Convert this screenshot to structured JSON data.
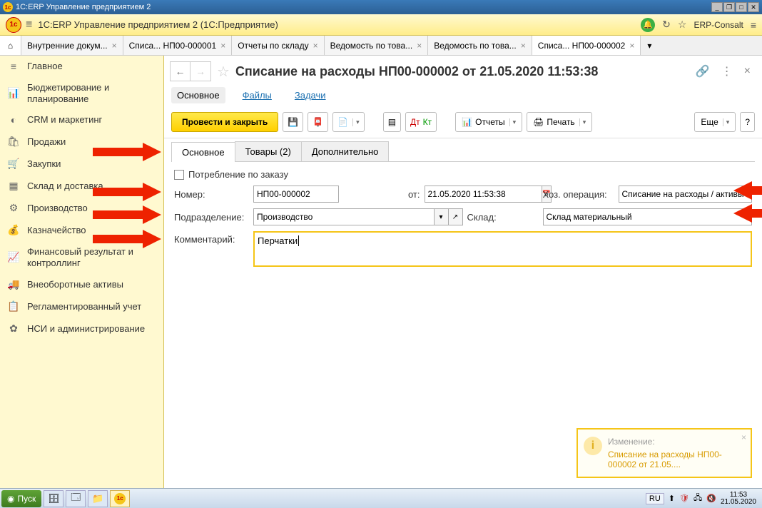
{
  "titlebar": {
    "app_title": "1C:ERP Управление предприятием 2"
  },
  "appbar": {
    "title": "1C:ERP Управление предприятием 2  (1С:Предприятие)",
    "erp_consult": "ERP-Consalt"
  },
  "tabs": [
    {
      "label": "Внутренние докум...",
      "active": false
    },
    {
      "label": "Списа... НП00-000001",
      "active": false
    },
    {
      "label": "Отчеты по складу",
      "active": false
    },
    {
      "label": "Ведомость по това...",
      "active": false
    },
    {
      "label": "Ведомость по това...",
      "active": false
    },
    {
      "label": "Списа... НП00-000002",
      "active": true
    }
  ],
  "sidebar": {
    "items": [
      {
        "icon": "≡",
        "label": "Главное"
      },
      {
        "icon": "📊",
        "label": "Бюджетирование и планирование"
      },
      {
        "icon": "◐",
        "label": "CRM и маркетинг"
      },
      {
        "icon": "🛍",
        "label": "Продажи"
      },
      {
        "icon": "🛒",
        "label": "Закупки"
      },
      {
        "icon": "▦",
        "label": "Склад и доставка"
      },
      {
        "icon": "⚙",
        "label": "Производство"
      },
      {
        "icon": "💰",
        "label": "Казначейство"
      },
      {
        "icon": "📈",
        "label": "Финансовый результат и контроллинг"
      },
      {
        "icon": "🚚",
        "label": "Внеоборотные активы"
      },
      {
        "icon": "📋",
        "label": "Регламентированный учет"
      },
      {
        "icon": "✿",
        "label": "НСИ и администрирование"
      }
    ]
  },
  "doc": {
    "title": "Списание на расходы НП00-000002 от 21.05.2020 11:53:38",
    "subnav": {
      "main": "Основное",
      "files": "Файлы",
      "tasks": "Задачи"
    },
    "toolbar": {
      "post_close": "Провести и закрыть",
      "reports": "Отчеты",
      "print": "Печать",
      "more": "Еще"
    },
    "inner_tabs": {
      "main": "Основное",
      "goods": "Товары (2)",
      "extra": "Дополнительно"
    },
    "form": {
      "consume_order_chk": "Потребление по заказу",
      "number_lbl": "Номер:",
      "number_val": "НП00-000002",
      "from_lbl": "от:",
      "date_val": "21.05.2020 11:53:38",
      "op_lbl": "Хоз. операция:",
      "op_val": "Списание на расходы / активы",
      "dept_lbl": "Подразделение:",
      "dept_val": "Производство",
      "stock_lbl": "Склад:",
      "stock_val": "Склад материальный",
      "comment_lbl": "Комментарий:",
      "comment_val": "Перчатки"
    }
  },
  "notification": {
    "title": "Изменение:",
    "body": "Списание на расходы НП00-000002 от 21.05...."
  },
  "taskbar": {
    "start": "Пуск",
    "lang": "RU",
    "time": "11:53",
    "date": "21.05.2020"
  }
}
